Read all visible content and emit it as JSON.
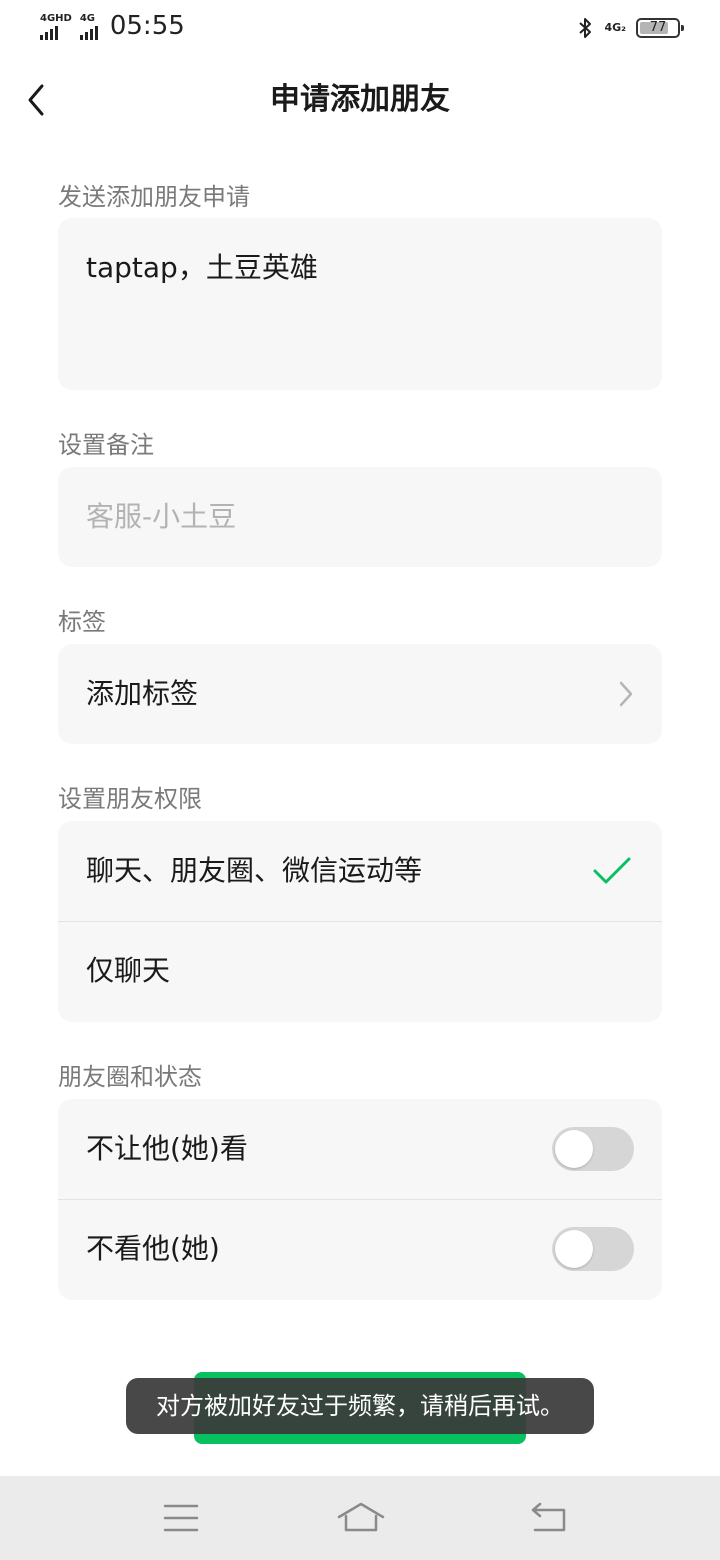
{
  "status_bar": {
    "net1": "4GHD",
    "net2": "4G",
    "time": "05:55",
    "net_right": "4G₂",
    "battery": "77",
    "battery_level": 0.77
  },
  "nav": {
    "title": "申请添加朋友",
    "back_icon": "chevron-left-icon"
  },
  "request": {
    "label": "发送添加朋友申请",
    "value": "taptap，土豆英雄"
  },
  "remark": {
    "label": "设置备注",
    "placeholder": "客服-小土豆"
  },
  "tags": {
    "label": "标签",
    "add_label": "添加标签"
  },
  "permissions": {
    "label": "设置朋友权限",
    "options": [
      {
        "label": "聊天、朋友圈、微信运动等",
        "selected": true
      },
      {
        "label": "仅聊天",
        "selected": false
      }
    ]
  },
  "moments": {
    "label": "朋友圈和状态",
    "items": [
      {
        "label": "不让他(她)看",
        "on": false
      },
      {
        "label": "不看他(她)",
        "on": false
      }
    ]
  },
  "toast": "对方被加好友过于频繁，请稍后再试。",
  "colors": {
    "accent_green": "#07c160",
    "card_bg": "#f7f7f7",
    "label_gray": "#7a7a7a"
  }
}
